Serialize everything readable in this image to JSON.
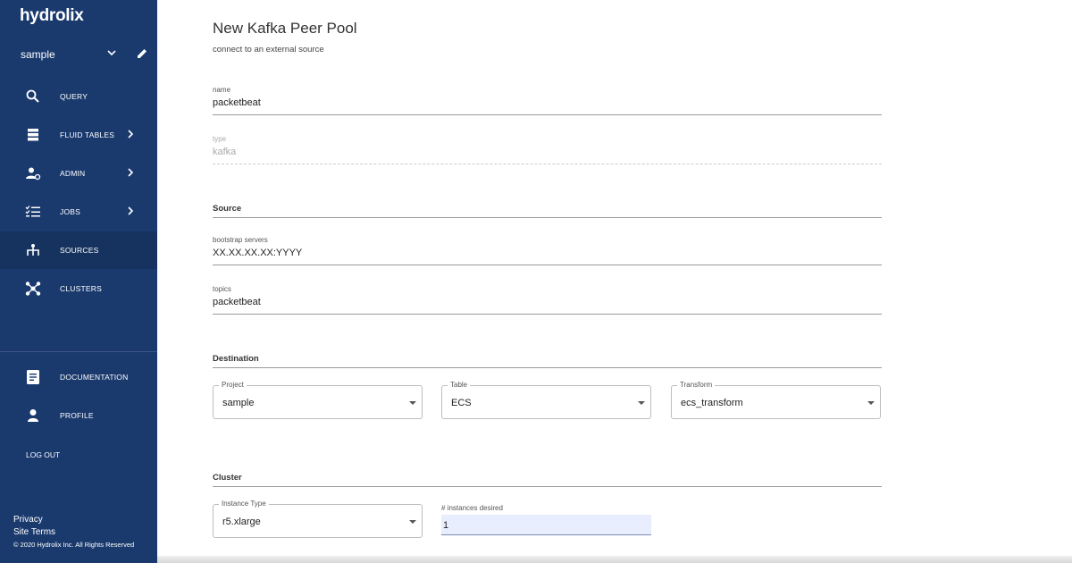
{
  "app": {
    "logo": "hydrolix"
  },
  "sidebar": {
    "project": "sample",
    "nav": [
      {
        "label": "QUERY",
        "icon": "search-icon"
      },
      {
        "label": "FLUID TABLES",
        "icon": "storage-icon"
      },
      {
        "label": "ADMIN",
        "icon": "admin-icon"
      },
      {
        "label": "JOBS",
        "icon": "checklist-icon"
      },
      {
        "label": "SOURCES",
        "icon": "sources-icon"
      },
      {
        "label": "CLUSTERS",
        "icon": "clusters-icon"
      }
    ],
    "bottom_nav": [
      {
        "label": "DOCUMENTATION",
        "icon": "document-icon"
      },
      {
        "label": "PROFILE",
        "icon": "person-icon"
      }
    ],
    "logout": "LOG OUT",
    "privacy": "Privacy",
    "terms": "Site Terms",
    "copyright": "© 2020 Hydrolix Inc. All Rights Reserved"
  },
  "form": {
    "title": "New Kafka Peer Pool",
    "subtitle": "connect to an external source",
    "name": {
      "label": "name",
      "value": "packetbeat"
    },
    "type": {
      "label": "type",
      "value": "kafka"
    },
    "source_heading": "Source",
    "bootstrap": {
      "label": "bootstrap servers",
      "value": "XX.XX.XX.XX:YYYY"
    },
    "topics": {
      "label": "topics",
      "value": "packetbeat"
    },
    "destination_heading": "Destination",
    "project": {
      "label": "Project",
      "value": "sample"
    },
    "table": {
      "label": "Table",
      "value": "ECS"
    },
    "transform": {
      "label": "Transform",
      "value": "ecs_transform"
    },
    "cluster_heading": "Cluster",
    "instance_type": {
      "label": "Instance Type",
      "value": "r5.xlarge"
    },
    "instances": {
      "label": "# instances desired",
      "value": "1"
    }
  }
}
